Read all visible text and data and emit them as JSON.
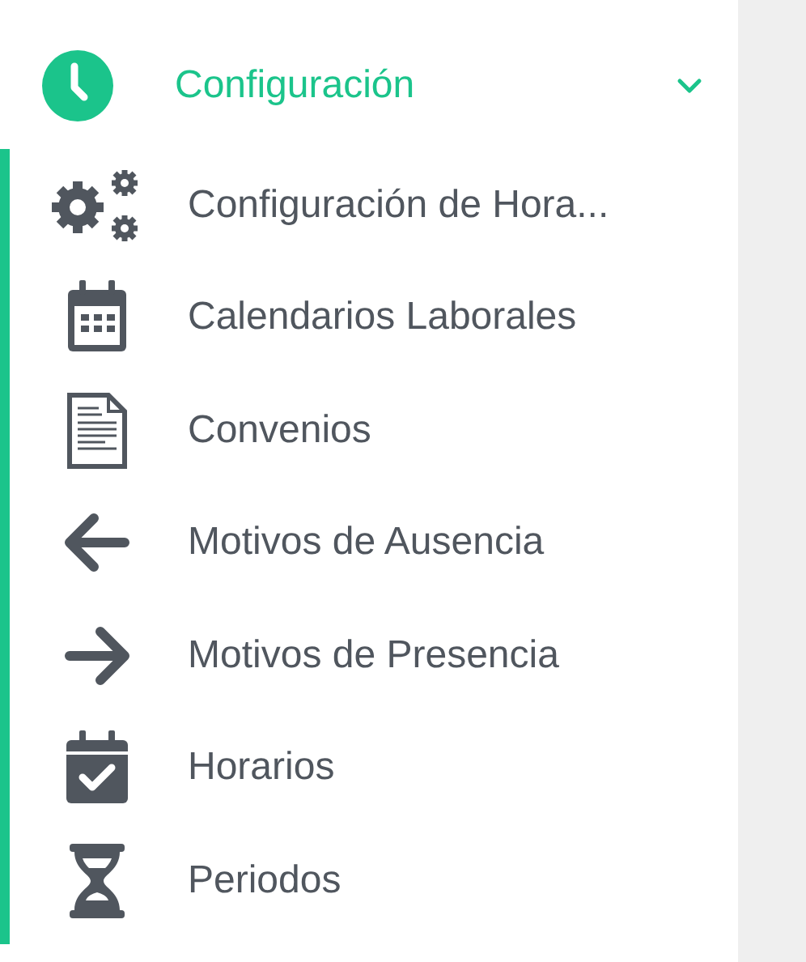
{
  "menu": {
    "label": "Configuración",
    "expanded": true,
    "items": [
      {
        "kind": "gears",
        "label": "Configuración de Hora..."
      },
      {
        "kind": "calendar",
        "label": "Calendarios Laborales"
      },
      {
        "kind": "document",
        "label": "Convenios"
      },
      {
        "kind": "arrow-left",
        "label": "Motivos de Ausencia"
      },
      {
        "kind": "arrow-right",
        "label": "Motivos de Presencia"
      },
      {
        "kind": "calendar-check",
        "label": "Horarios"
      },
      {
        "kind": "hourglass",
        "label": "Periodos"
      }
    ]
  }
}
